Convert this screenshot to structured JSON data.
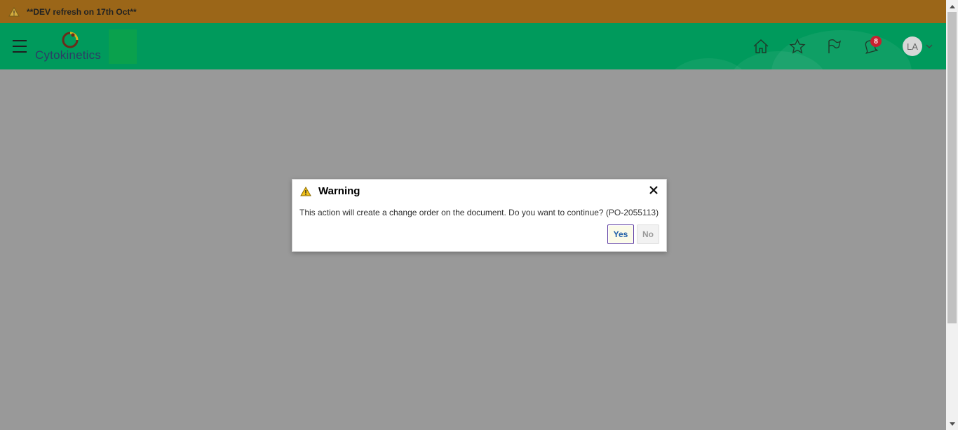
{
  "banner": {
    "text": "**DEV refresh on 17th Oct**",
    "icon": "warning-icon"
  },
  "header": {
    "logo_text": "Cytokinetics",
    "notifications_count": "8",
    "avatar_initials": "LA",
    "icons": [
      "home-icon",
      "favorites-star-icon",
      "flag-icon",
      "notifications-icon"
    ],
    "colors": {
      "banner": "#9b6618",
      "header": "#009a5c",
      "overlay": "#999999"
    }
  },
  "dialog": {
    "title": "Warning",
    "message": "This action will create a change order on the document. Do you want to continue? (PO-2055113)",
    "yes_label": "Yes",
    "no_label": "No"
  }
}
